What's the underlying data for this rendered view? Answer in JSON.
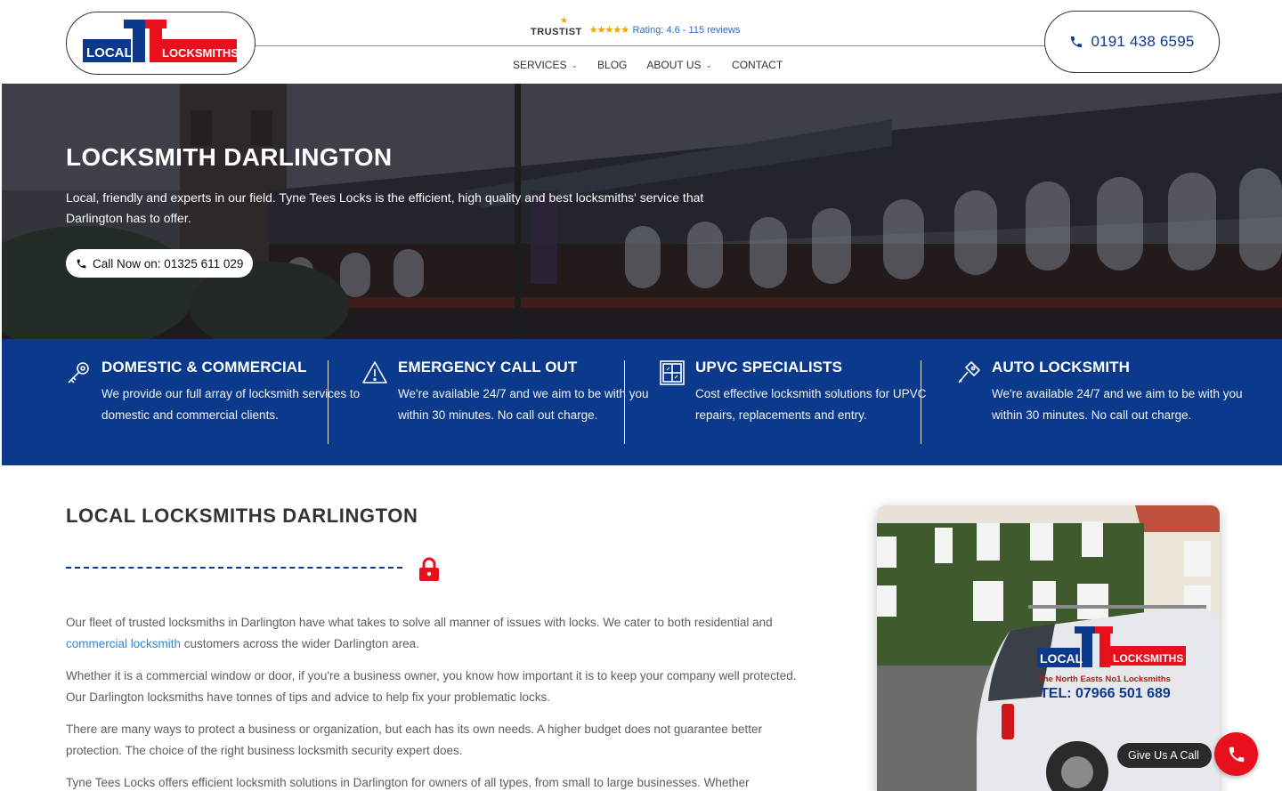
{
  "header": {
    "logo": {
      "word_left": "LOCAL",
      "word_right": "LOCKSMITHS"
    },
    "trustist": {
      "brand": "TRUSTIST",
      "stars": "★★★★★",
      "rating_text": "Rating: 4.6 - 115 reviews"
    },
    "phone": "0191 438 6595",
    "nav": [
      {
        "label": "SERVICES",
        "dropdown": true
      },
      {
        "label": "BLOG",
        "dropdown": false
      },
      {
        "label": "ABOUT US",
        "dropdown": true
      },
      {
        "label": "CONTACT",
        "dropdown": false
      }
    ]
  },
  "hero": {
    "title": "LOCKSMITH DARLINGTON",
    "subtitle": "Local, friendly and experts in our field. Tyne Tees Locks is the efficient, high quality and best locksmiths' service that Darlington has to offer.",
    "cta_label": "Call Now on: 01325 611 029"
  },
  "features": [
    {
      "icon": "key-icon",
      "title": "DOMESTIC & COMMERCIAL",
      "text": "We provide our full array of locksmith services to domestic and commercial clients."
    },
    {
      "icon": "warning-icon",
      "title": "EMERGENCY CALL OUT",
      "text": "We're available 24/7 and we aim to be with you within 30 minutes. No call out charge."
    },
    {
      "icon": "window-icon",
      "title": "UPVC SPECIALISTS",
      "text": "Cost effective locksmith solutions for UPVC repairs, replacements and entry."
    },
    {
      "icon": "key-icon",
      "title": "AUTO LOCKSMITH",
      "text": "We're available 24/7 and we aim to be with you within 30 minutes. No call out charge."
    }
  ],
  "content": {
    "heading": "LOCAL LOCKSMITHS DARLINGTON",
    "p1_before": "Our fleet of trusted locksmiths in Darlington have what takes to solve all manner of issues with locks. We cater to both residential and ",
    "p1_link": "commercial locksmith",
    "p1_after": " customers across the wider Darlington area.",
    "p2": "Whether it is a commercial window or door, if you're a business owner, you know how important it is to keep your company well protected. Our Darlington locksmiths have tonnes of tips and advice to help fix your problematic locks.",
    "p3": "There are many ways to protect a business or organization, but each has its own needs. A higher budget does not guarantee better protection. The choice of the right business locksmith security expert does.",
    "p4": "Tyne Tees Locks offers efficient locksmith solutions in Darlington for owners of all types, from small to large businesses. Whether"
  },
  "van_photo": {
    "logo_left": "LOCAL",
    "logo_right": "LOCKSMITHS",
    "tagline": "The North Easts No1 Locksmiths",
    "tel": "TEL: 07966 501 689"
  },
  "floating_call": {
    "label": "Give Us A Call"
  },
  "colors": {
    "brand_blue": "#0b3a8d",
    "brand_red": "#e8101c",
    "link": "#2a88d8"
  }
}
